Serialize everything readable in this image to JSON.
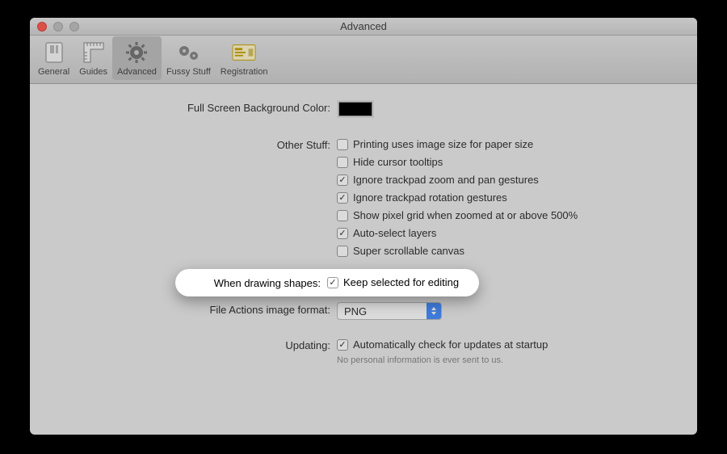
{
  "window": {
    "title": "Advanced"
  },
  "toolbar": {
    "general": "General",
    "guides": "Guides",
    "advanced": "Advanced",
    "fussy": "Fussy Stuff",
    "registration": "Registration"
  },
  "labels": {
    "bg_color": "Full Screen Background Color:",
    "other_stuff": "Other Stuff:",
    "drawing_shapes": "When drawing shapes:",
    "file_actions_format": "File Actions image format:",
    "updating": "Updating:"
  },
  "options": {
    "other_stuff": [
      {
        "label": "Printing uses image size for paper size",
        "checked": false
      },
      {
        "label": "Hide cursor tooltips",
        "checked": false
      },
      {
        "label": "Ignore trackpad zoom and pan gestures",
        "checked": true
      },
      {
        "label": "Ignore trackpad rotation gestures",
        "checked": true
      },
      {
        "label": "Show pixel grid when zoomed at or above 500%",
        "checked": false
      },
      {
        "label": "Auto-select layers",
        "checked": true
      },
      {
        "label": "Super scrollable canvas",
        "checked": false
      }
    ],
    "drawing_shapes": {
      "label": "Keep selected for editing",
      "checked": true
    },
    "file_format": "PNG",
    "updating": {
      "label": "Automatically check for updates at startup",
      "checked": true
    },
    "updating_note": "No personal information is ever sent to us."
  },
  "colors": {
    "bg_well": "#000000"
  }
}
